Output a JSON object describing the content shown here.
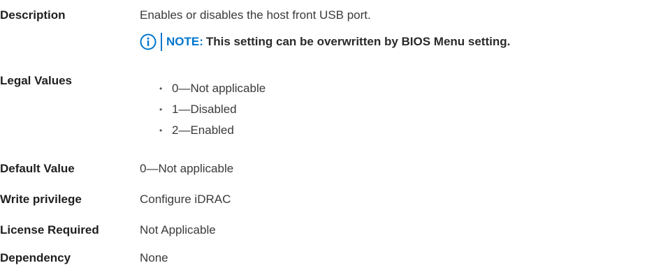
{
  "description": {
    "label": "Description",
    "text": "Enables or disables the host front USB port.",
    "note": {
      "prefix": "NOTE:",
      "text": "This setting can be overwritten by BIOS Menu setting."
    }
  },
  "legal_values": {
    "label": "Legal Values",
    "items": [
      "0—Not applicable",
      "1—Disabled",
      "2—Enabled"
    ]
  },
  "default_value": {
    "label": "Default Value",
    "value": "0—Not applicable"
  },
  "write_privilege": {
    "label": "Write privilege",
    "value": "Configure iDRAC"
  },
  "license_required": {
    "label": "License Required",
    "value": "Not Applicable"
  },
  "dependency": {
    "label": "Dependency",
    "value": "None"
  },
  "colors": {
    "accent": "#0076CE",
    "text": "#2A2A2A"
  },
  "icons": {
    "note": "info-circle-icon",
    "bullet": "bullet-dot-icon"
  }
}
